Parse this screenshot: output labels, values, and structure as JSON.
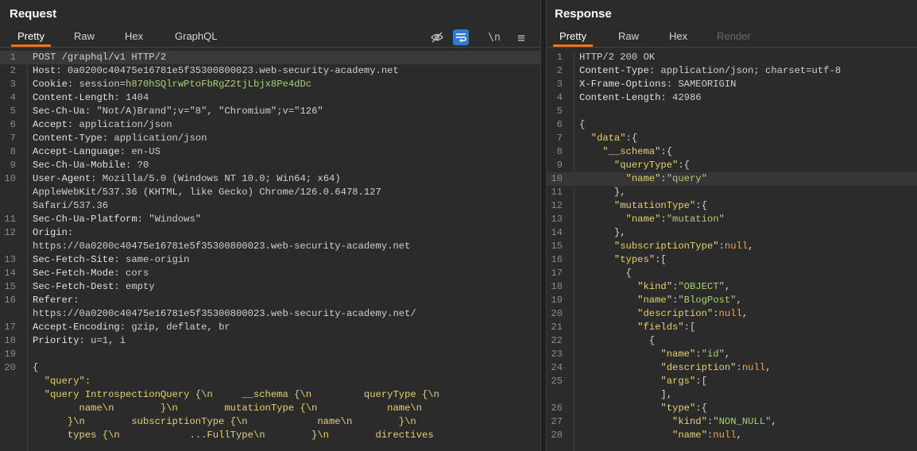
{
  "request": {
    "title": "Request",
    "tabs": [
      "Pretty",
      "Raw",
      "Hex",
      "GraphQL"
    ],
    "active_tab": "Pretty",
    "tools": {
      "newline_label": "\\n"
    },
    "lines": [
      {
        "n": "1",
        "t": "POST /graphql/v1 HTTP/2"
      },
      {
        "n": "2",
        "k": "Host",
        "v": "0a0200c40475e16781e5f35300800023.web-security-academy.net"
      },
      {
        "n": "3",
        "k": "Cookie",
        "v": "session=",
        "vg": "h870hSQlrwPtoFbRgZ2tjLbjx8Pe4dDc"
      },
      {
        "n": "4",
        "k": "Content-Length",
        "v": "1404"
      },
      {
        "n": "5",
        "k": "Sec-Ch-Ua",
        "v": "\"Not/A)Brand\";v=\"8\", \"Chromium\";v=\"126\""
      },
      {
        "n": "6",
        "k": "Accept",
        "v": "application/json"
      },
      {
        "n": "7",
        "k": "Content-Type",
        "v": "application/json"
      },
      {
        "n": "8",
        "k": "Accept-Language",
        "v": "en-US"
      },
      {
        "n": "9",
        "k": "Sec-Ch-Ua-Mobile",
        "v": "?0"
      },
      {
        "n": "10",
        "k": "User-Agent",
        "v": "Mozilla/5.0 (Windows NT 10.0; Win64; x64)"
      },
      {
        "n": "",
        "t": "AppleWebKit/537.36 (KHTML, like Gecko) Chrome/126.0.6478.127"
      },
      {
        "n": "",
        "t": "Safari/537.36"
      },
      {
        "n": "11",
        "k": "Sec-Ch-Ua-Platform",
        "v": "\"Windows\""
      },
      {
        "n": "12",
        "k": "Origin",
        "v": ""
      },
      {
        "n": "",
        "t": "https://0a0200c40475e16781e5f35300800023.web-security-academy.net"
      },
      {
        "n": "13",
        "k": "Sec-Fetch-Site",
        "v": "same-origin"
      },
      {
        "n": "14",
        "k": "Sec-Fetch-Mode",
        "v": "cors"
      },
      {
        "n": "15",
        "k": "Sec-Fetch-Dest",
        "v": "empty"
      },
      {
        "n": "16",
        "k": "Referer",
        "v": ""
      },
      {
        "n": "",
        "t": "https://0a0200c40475e16781e5f35300800023.web-security-academy.net/"
      },
      {
        "n": "17",
        "k": "Accept-Encoding",
        "v": "gzip, deflate, br"
      },
      {
        "n": "18",
        "k": "Priority",
        "v": "u=1, i"
      },
      {
        "n": "19",
        "t": ""
      },
      {
        "n": "20",
        "t": "{"
      },
      {
        "n": "",
        "j": "  \"query\":"
      },
      {
        "n": "",
        "j": "  \"query IntrospectionQuery {\\n     __schema {\\n         queryType {\\n"
      },
      {
        "n": "",
        "j": "        name\\n        }\\n        mutationType {\\n            name\\n"
      },
      {
        "n": "",
        "j": "      }\\n        subscriptionType {\\n            name\\n        }\\n"
      },
      {
        "n": "",
        "j": "      types {\\n            ...FullType\\n        }\\n        directives"
      }
    ]
  },
  "response": {
    "title": "Response",
    "tabs": [
      "Pretty",
      "Raw",
      "Hex",
      "Render"
    ],
    "active_tab": "Pretty",
    "lines": [
      {
        "n": "1",
        "t": "HTTP/2 200 OK"
      },
      {
        "n": "2",
        "k": "Content-Type",
        "v": "application/json; charset=utf-8"
      },
      {
        "n": "3",
        "k": "X-Frame-Options",
        "v": "SAMEORIGIN"
      },
      {
        "n": "4",
        "k": "Content-Length",
        "v": "42986"
      },
      {
        "n": "5",
        "t": ""
      },
      {
        "n": "6",
        "t": "{"
      },
      {
        "n": "7",
        "i": "  ",
        "key": "\"data\"",
        "rest": ":{"
      },
      {
        "n": "8",
        "i": "    ",
        "key": "\"__schema\"",
        "rest": ":{"
      },
      {
        "n": "9",
        "i": "      ",
        "key": "\"queryType\"",
        "rest": ":{"
      },
      {
        "n": "10",
        "i": "        ",
        "key": "\"name\"",
        "rest": ":",
        "str": "\"query\""
      },
      {
        "n": "11",
        "i": "      ",
        "rest": "},"
      },
      {
        "n": "12",
        "i": "      ",
        "key": "\"mutationType\"",
        "rest": ":{"
      },
      {
        "n": "13",
        "i": "        ",
        "key": "\"name\"",
        "rest": ":",
        "str": "\"mutation\""
      },
      {
        "n": "14",
        "i": "      ",
        "rest": "},"
      },
      {
        "n": "15",
        "i": "      ",
        "key": "\"subscriptionType\"",
        "rest": ":",
        "kw": "null",
        "tail": ","
      },
      {
        "n": "16",
        "i": "      ",
        "key": "\"types\"",
        "rest": ":["
      },
      {
        "n": "17",
        "i": "        ",
        "rest": "{"
      },
      {
        "n": "18",
        "i": "          ",
        "key": "\"kind\"",
        "rest": ":",
        "str": "\"OBJECT\"",
        "tail": ","
      },
      {
        "n": "19",
        "i": "          ",
        "key": "\"name\"",
        "rest": ":",
        "str": "\"BlogPost\"",
        "tail": ","
      },
      {
        "n": "20",
        "i": "          ",
        "key": "\"description\"",
        "rest": ":",
        "kw": "null",
        "tail": ","
      },
      {
        "n": "21",
        "i": "          ",
        "key": "\"fields\"",
        "rest": ":["
      },
      {
        "n": "22",
        "i": "            ",
        "rest": "{"
      },
      {
        "n": "23",
        "i": "              ",
        "key": "\"name\"",
        "rest": ":",
        "str": "\"id\"",
        "tail": ","
      },
      {
        "n": "24",
        "i": "              ",
        "key": "\"description\"",
        "rest": ":",
        "kw": "null",
        "tail": ","
      },
      {
        "n": "25",
        "i": "              ",
        "key": "\"args\"",
        "rest": ":["
      },
      {
        "n": "",
        "i": "              ",
        "rest": "],"
      },
      {
        "n": "26",
        "i": "              ",
        "key": "\"type\"",
        "rest": ":{"
      },
      {
        "n": "27",
        "i": "                ",
        "key": "\"kind\"",
        "rest": ":",
        "str": "\"NON_NULL\"",
        "tail": ","
      },
      {
        "n": "28",
        "i": "                ",
        "key": "\"name\"",
        "rest": ":",
        "kw": "null",
        "tail": ","
      }
    ]
  }
}
